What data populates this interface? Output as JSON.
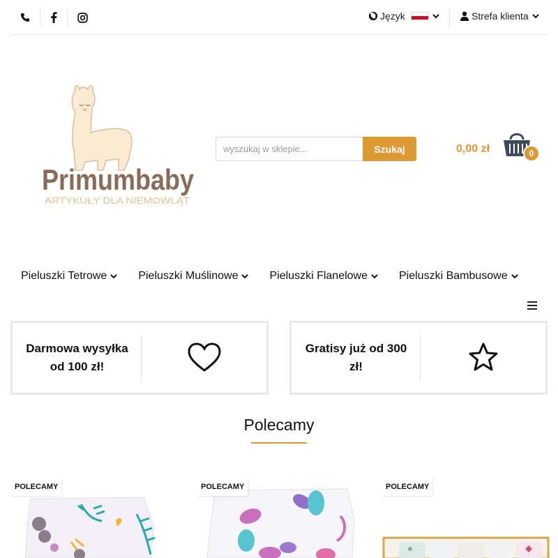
{
  "topbar": {
    "icons": [
      "phone-icon",
      "facebook-icon",
      "instagram-icon"
    ],
    "language_label": "Język",
    "client_label": "Strefa klienta"
  },
  "logo": {
    "brand": "Primumbaby",
    "tagline": "ARTYKUŁY DLA NIEMOWLĄT"
  },
  "search": {
    "placeholder": "wyszukaj w sklepie...",
    "button_label": "Szukaj"
  },
  "cart": {
    "total": "0,00 zł",
    "count": "0"
  },
  "nav": {
    "items": [
      {
        "label": "Pieluszki Tetrowe"
      },
      {
        "label": "Pieluszki Muślinowe"
      },
      {
        "label": "Pieluszki Flanelowe"
      },
      {
        "label": "Pieluszki Bambusowe"
      }
    ]
  },
  "features": [
    {
      "text": "Darmowa wysyłka od 100 zł!",
      "icon": "heart-icon"
    },
    {
      "text": "Gratisy już od 300 zł!",
      "icon": "star-icon"
    }
  ],
  "section": {
    "title": "Polecamy"
  },
  "products": [
    {
      "badge": "POLECAMY"
    },
    {
      "badge": "POLECAMY"
    },
    {
      "badge": "POLECAMY"
    }
  ],
  "colors": {
    "accent": "#dd9933",
    "text": "#222222",
    "border": "#e8e8e8",
    "logo_brown": "#8a6b5a"
  }
}
